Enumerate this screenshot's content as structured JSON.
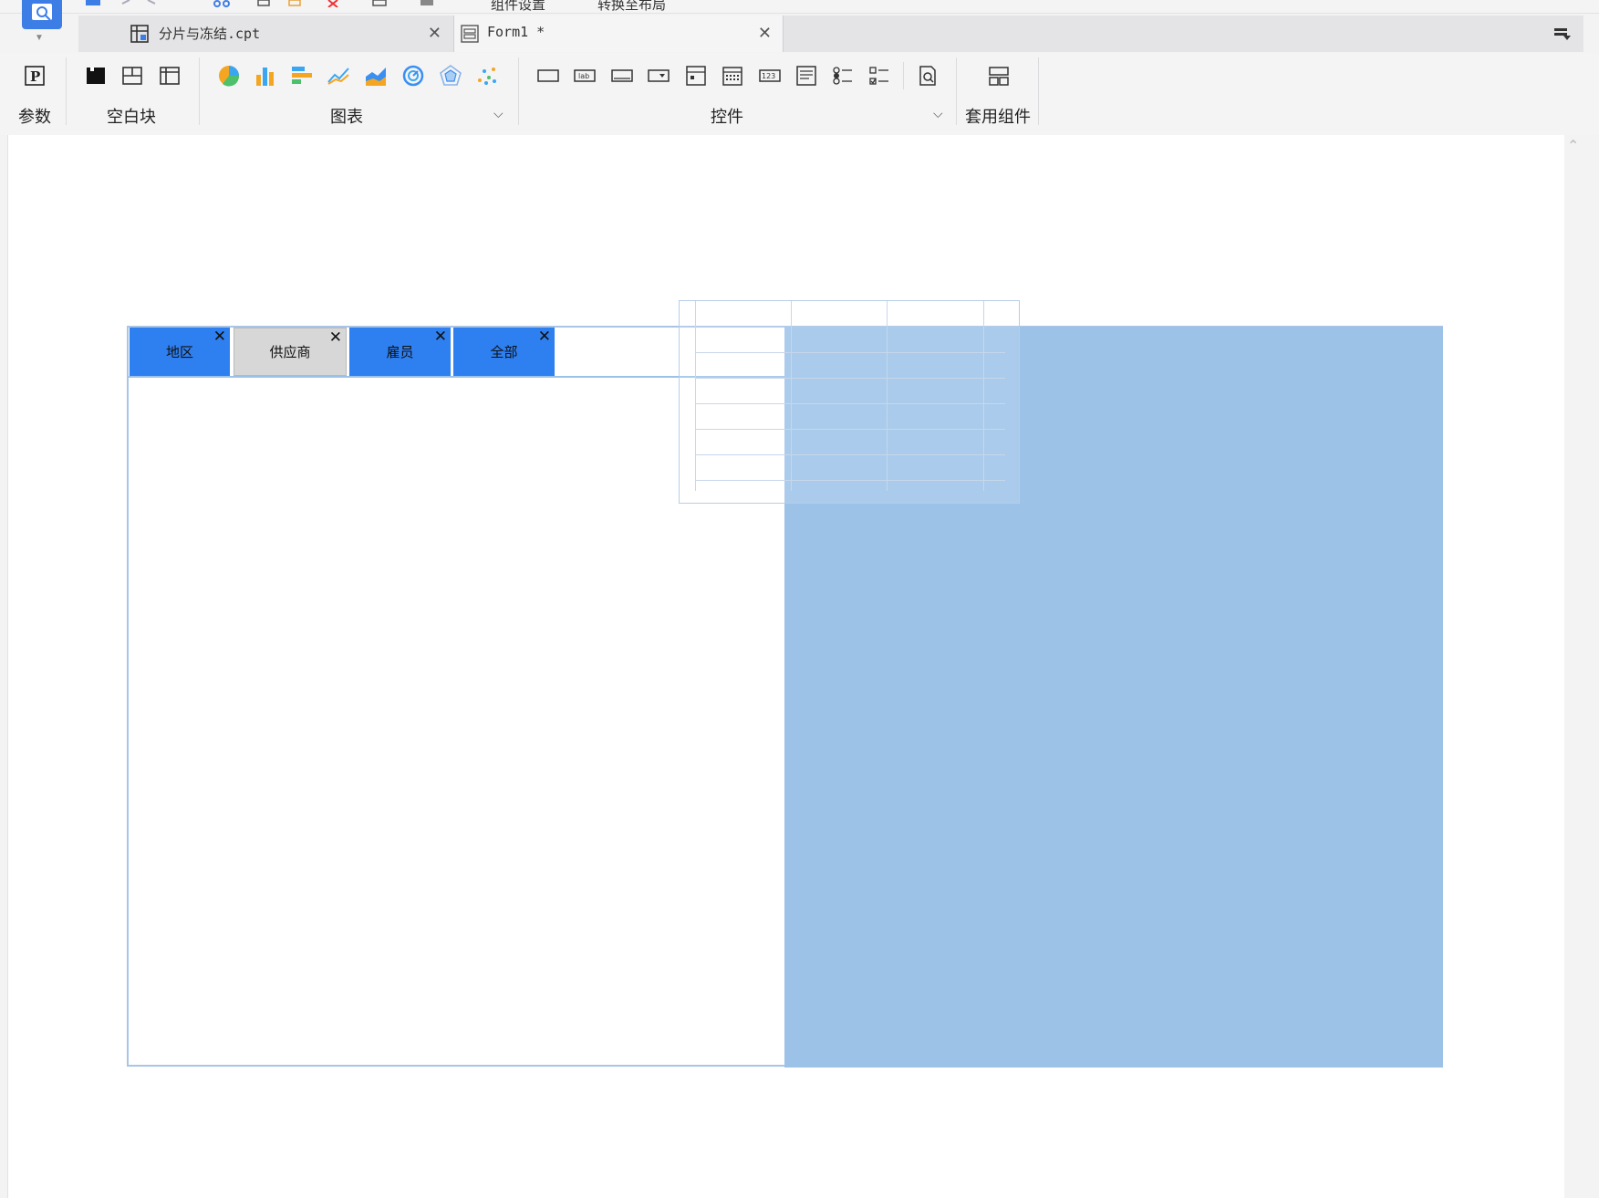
{
  "toolbar_top": {
    "item_a": "组件设置",
    "item_b": "转换至布局"
  },
  "tabs": [
    {
      "label": "分片与冻结.cpt",
      "close": "✕"
    },
    {
      "label": "Form1 *",
      "close": "✕"
    }
  ],
  "ribbon": {
    "param_label": "参数",
    "blank_block_label": "空白块",
    "chart_label": "图表",
    "controls_label": "控件",
    "template_component_label": "套用组件"
  },
  "form": {
    "tabs": [
      {
        "label": "地区",
        "state": "active"
      },
      {
        "label": "供应商",
        "state": "inactive"
      },
      {
        "label": "雇员",
        "state": "active"
      },
      {
        "label": "全部",
        "state": "active"
      }
    ],
    "close_glyph": "✕"
  },
  "colors": {
    "accent": "#2e7ff0",
    "selection": "#9cc2e8",
    "tab_bar": "#e4e4e6"
  }
}
